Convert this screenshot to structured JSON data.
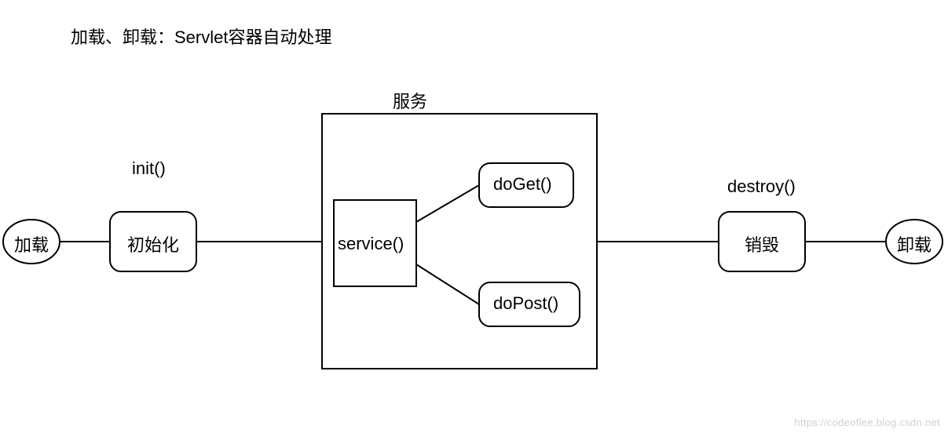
{
  "title": "加载、卸载：Servlet容器自动处理",
  "nodes": {
    "load": "加载",
    "init_label": "init()",
    "init_box": "初始化",
    "service_header": "服务",
    "service_box": "service()",
    "doGet": "doGet()",
    "doPost": "doPost()",
    "destroy_label": "destroy()",
    "destroy_box": "销毁",
    "unload": "卸载"
  },
  "watermark": "https://codeoflee.blog.csdn.net"
}
